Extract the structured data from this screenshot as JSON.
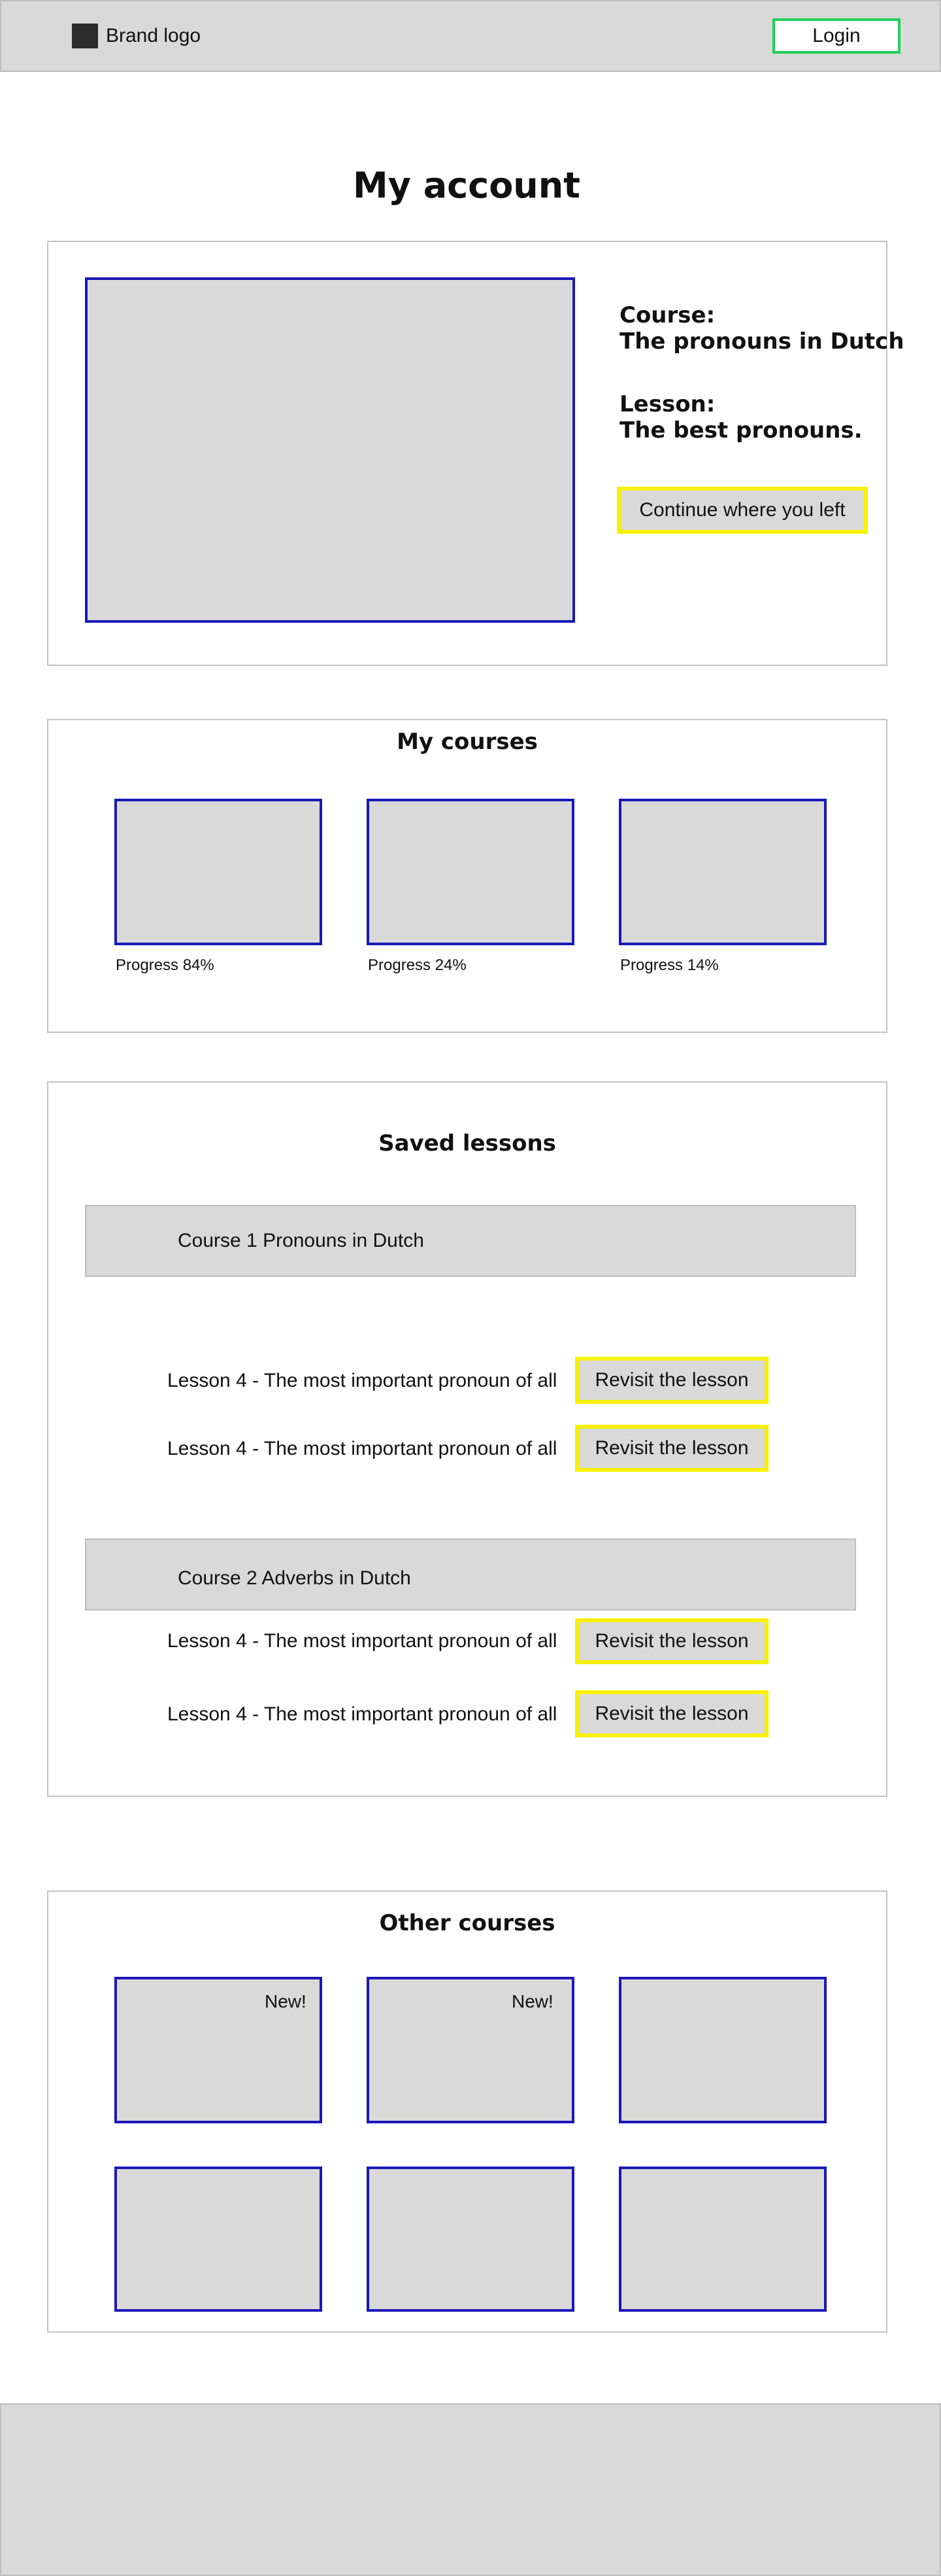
{
  "header": {
    "brand": "Brand logo",
    "login_label": "Login"
  },
  "page_title": "My account",
  "current": {
    "course_label": "Course:",
    "course_name": "The pronouns in Dutch",
    "lesson_label": "Lesson:",
    "lesson_name": "The best pronouns.",
    "continue_label": "Continue where you left"
  },
  "my_courses": {
    "title": "My courses",
    "items": [
      {
        "progress_text": "Progress 84%",
        "progress": 0.84
      },
      {
        "progress_text": "Progress 24%",
        "progress": 0.24
      },
      {
        "progress_text": "Progress 14%",
        "progress": 0.14
      }
    ]
  },
  "saved": {
    "title": "Saved lessons",
    "groups": [
      {
        "course": "Course 1 Pronouns in Dutch",
        "lessons": [
          {
            "title": "Lesson 4 - The most important pronoun of all",
            "action": "Revisit the lesson"
          },
          {
            "title": "Lesson 4 - The most important pronoun of all",
            "action": "Revisit the lesson"
          }
        ]
      },
      {
        "course": "Course 2 Adverbs in Dutch",
        "lessons": [
          {
            "title": "Lesson 4 - The most important pronoun of all",
            "action": "Revisit the lesson"
          },
          {
            "title": "Lesson 4 - The most important pronoun of all",
            "action": "Revisit the lesson"
          }
        ]
      }
    ]
  },
  "other_courses": {
    "title": "Other courses",
    "items": [
      {
        "badge": "New!"
      },
      {
        "badge": "New!"
      },
      {
        "badge": ""
      },
      {
        "badge": ""
      },
      {
        "badge": ""
      },
      {
        "badge": ""
      }
    ]
  },
  "colors": {
    "placeholder_gray": "#d9d9d9",
    "thumb_border": "#1a18b8",
    "highlight_button_border": "#f7f000",
    "login_border": "#1fd05a",
    "logo": "#2b2b2b"
  }
}
